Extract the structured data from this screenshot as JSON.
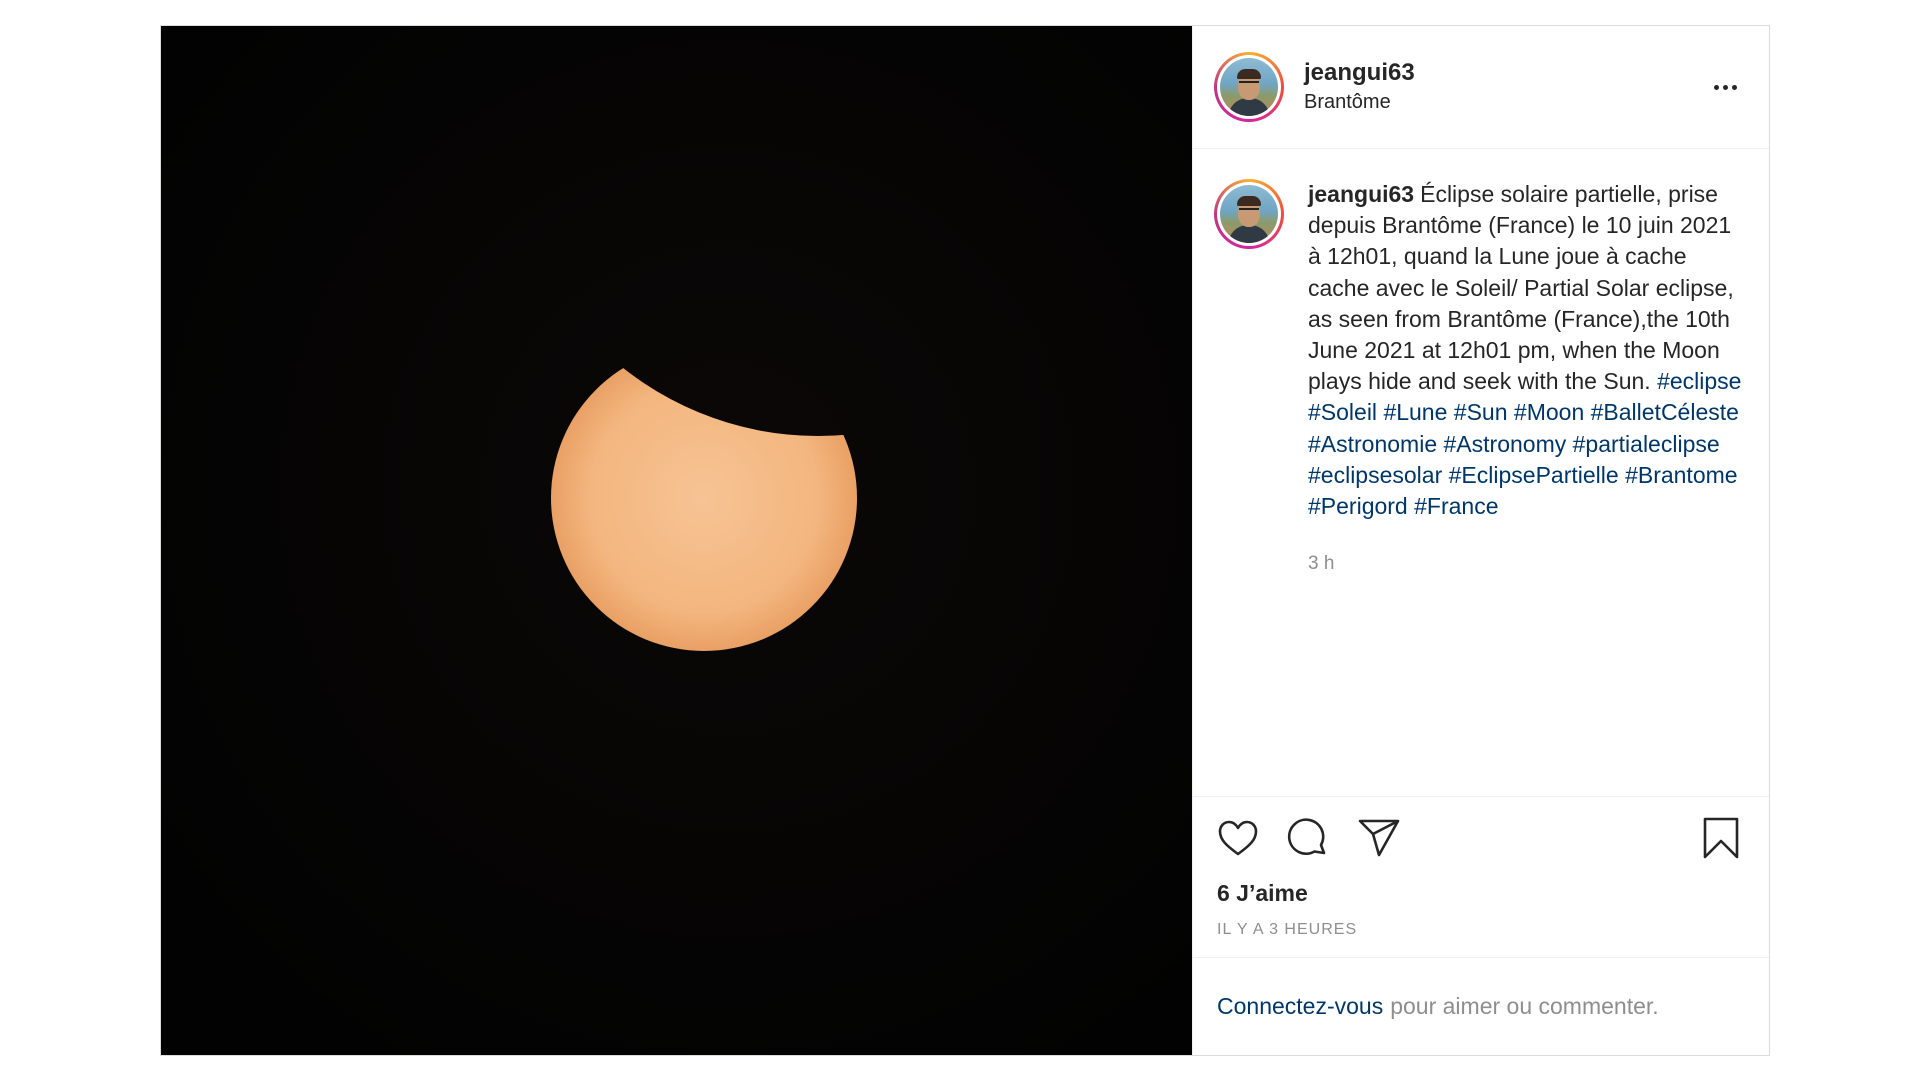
{
  "post": {
    "username": "jeangui63",
    "location": "Brantôme",
    "caption_text": "Éclipse solaire partielle, prise depuis Brantôme (France) le 10 juin 2021 à 12h01, quand la Lune joue à cache cache avec le Soleil/ Partial Solar eclipse, as seen from Brantôme (France),the 10th June 2021 at 12h01 pm, when the Moon plays hide and seek with the Sun.",
    "hashtags": [
      "#eclipse",
      "#Soleil",
      "#Lune",
      "#Sun",
      "#Moon",
      "#BalletCéleste",
      "#Astronomie",
      "#Astronomy",
      "#partialeclipse",
      "#eclipsesolar",
      "#EclipsePartielle",
      "#Brantome",
      "#Perigord",
      "#France"
    ],
    "caption_time": "3 h",
    "likes": "6 J’aime",
    "posted_ago": "IL Y A 3 HEURES"
  },
  "login": {
    "link": "Connectez-vous",
    "text": "pour aimer ou commenter."
  },
  "icons": {
    "more": "more-options-icon",
    "like": "heart-icon",
    "comment": "comment-icon",
    "share": "paper-plane-icon",
    "save": "bookmark-icon"
  },
  "colors": {
    "link": "#00376b",
    "muted": "#8e8e8e",
    "sun": "#f5bd88",
    "sky": "#050404"
  }
}
